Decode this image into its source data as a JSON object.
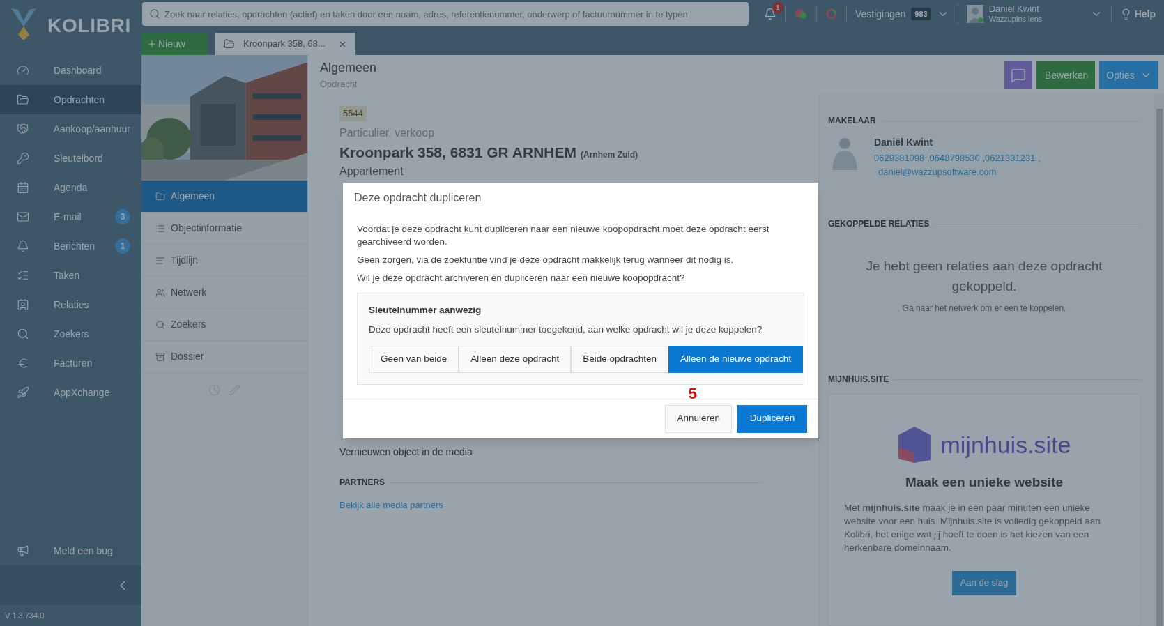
{
  "app": {
    "logo_text": "KOLIBRI",
    "version": "V 1.3.734.0"
  },
  "search": {
    "placeholder": "Zoek naar relaties, opdrachten (actief) en taken door een naam, adres, referentienummer, onderwerp of factuurnummer in te typen"
  },
  "topbar": {
    "notification_count": "1",
    "branches_label": "Vestigingen",
    "branches_count": "983",
    "user_name": "Daniël Kwint",
    "user_company": "Wazzupins lens",
    "help": "Help"
  },
  "sidebar": {
    "items": [
      {
        "label": "Dashboard",
        "selected": false
      },
      {
        "label": "Opdrachten",
        "selected": true
      },
      {
        "label": "Aankoop/aanhuur",
        "selected": false
      },
      {
        "label": "Sleutelbord",
        "selected": false
      },
      {
        "label": "Agenda",
        "selected": false
      },
      {
        "label": "E-mail",
        "badge": "3",
        "selected": false
      },
      {
        "label": "Berichten",
        "badge": "1",
        "selected": false
      },
      {
        "label": "Taken",
        "selected": false
      },
      {
        "label": "Relaties",
        "selected": false
      },
      {
        "label": "Zoekers",
        "selected": false
      },
      {
        "label": "Facturen",
        "selected": false
      },
      {
        "label": "AppXchange",
        "selected": false
      }
    ],
    "bug_report": "Meld een bug"
  },
  "tabs": {
    "new_button": "Nieuw",
    "items": [
      {
        "label": "Kroonpark 358, 68...",
        "selected": true
      }
    ]
  },
  "object_nav": {
    "items": [
      {
        "label": "Algemeen",
        "selected": true
      },
      {
        "label": "Objectinformatie",
        "selected": false
      },
      {
        "label": "Tijdlijn",
        "selected": false
      },
      {
        "label": "Netwerk",
        "selected": false
      },
      {
        "label": "Zoekers",
        "selected": false
      },
      {
        "label": "Dossier",
        "selected": false
      }
    ]
  },
  "header": {
    "title": "Algemeen",
    "subtitle": "Opdracht",
    "edit_button": "Bewerken",
    "options_button": "Opties"
  },
  "object": {
    "reference": "5544",
    "category": "Particulier, verkoop",
    "address": "Kroonpark 358, 6831 GR ARNHEM",
    "district": "(Arnhem Zuid)",
    "type": "Appartement",
    "media_note": "Vernieuwen object in de media"
  },
  "partners": {
    "heading": "PARTNERS",
    "link": "Bekijk alle media partners"
  },
  "agent": {
    "heading": "MAKELAAR",
    "name": "Daniël Kwint",
    "phones": "0629381098 ,0648798530 ,0621331231 ,",
    "email": "daniel@wazzupsoftware.com"
  },
  "relations": {
    "heading": "GEKOPPELDE RELATIES",
    "empty_title": "Je hebt geen relaties aan deze opdracht gekoppeld.",
    "empty_hint": "Ga naar het netwerk om er een te koppelen."
  },
  "mijnhuis": {
    "heading": "MIJNHUIS.SITE",
    "logo_text": "mijnhuis.site",
    "title": "Maak een unieke website",
    "text": "Met **mijnhuis.site** maak je in een paar minuten een unieke website voor een huis. Mijnhuis.site is volledig gekoppeld aan Kolibri, het enige wat jij hoeft te doen is het kiezen van een herkenbare domeinnaam.",
    "button": "Aan de slag"
  },
  "dialog": {
    "title": "Deze opdracht dupliceren",
    "paragraphs": [
      "Voordat je deze opdracht kunt dupliceren naar een nieuwe koopopdracht moet deze opdracht eerst gearchiveerd worden.",
      "Geen zorgen, via de zoekfuntie vind je deze opdracht makkelijk terug wanneer dit nodig is.",
      "Wil je deze opdracht archiveren en dupliceren naar een nieuwe koopopdracht?"
    ],
    "key_box": {
      "title": "Sleutelnummer aanwezig",
      "question": "Deze opdracht heeft een sleutelnummer toegekend, aan welke opdracht wil je deze koppelen?",
      "options": [
        {
          "label": "Geen van beide",
          "selected": false
        },
        {
          "label": "Alleen deze opdracht",
          "selected": false
        },
        {
          "label": "Beide opdrachten",
          "selected": false
        },
        {
          "label": "Alleen de nieuwe opdracht",
          "selected": true
        }
      ]
    },
    "buttons": [
      {
        "label": "Annuleren",
        "kind": "secondary"
      },
      {
        "label": "Dupliceren",
        "kind": "primary"
      }
    ],
    "step_marker": "5"
  }
}
